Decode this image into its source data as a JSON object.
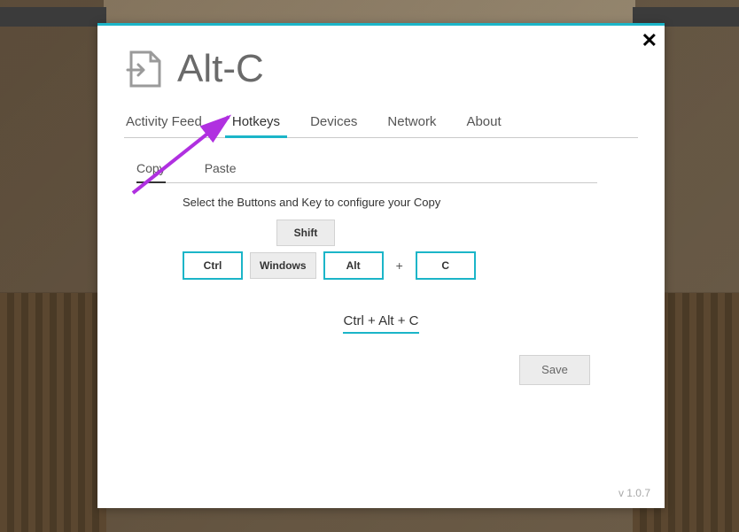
{
  "app_title": "Alt-C",
  "tabs": [
    "Activity Feed",
    "Hotkeys",
    "Devices",
    "Network",
    "About"
  ],
  "active_tab": 1,
  "subtabs": [
    "Copy",
    "Paste"
  ],
  "active_subtab": 0,
  "instruction": "Select the Buttons and Key to configure your Copy",
  "keys": {
    "shift": "Shift",
    "ctrl": "Ctrl",
    "windows": "Windows",
    "alt": "Alt",
    "plus": "+",
    "letter": "C"
  },
  "result": "Ctrl + Alt + C",
  "save_label": "Save",
  "version": "v 1.0.7",
  "icons": {
    "logo": "document-import-icon",
    "close": "close-icon"
  },
  "colors": {
    "accent": "#1bb5c8"
  }
}
